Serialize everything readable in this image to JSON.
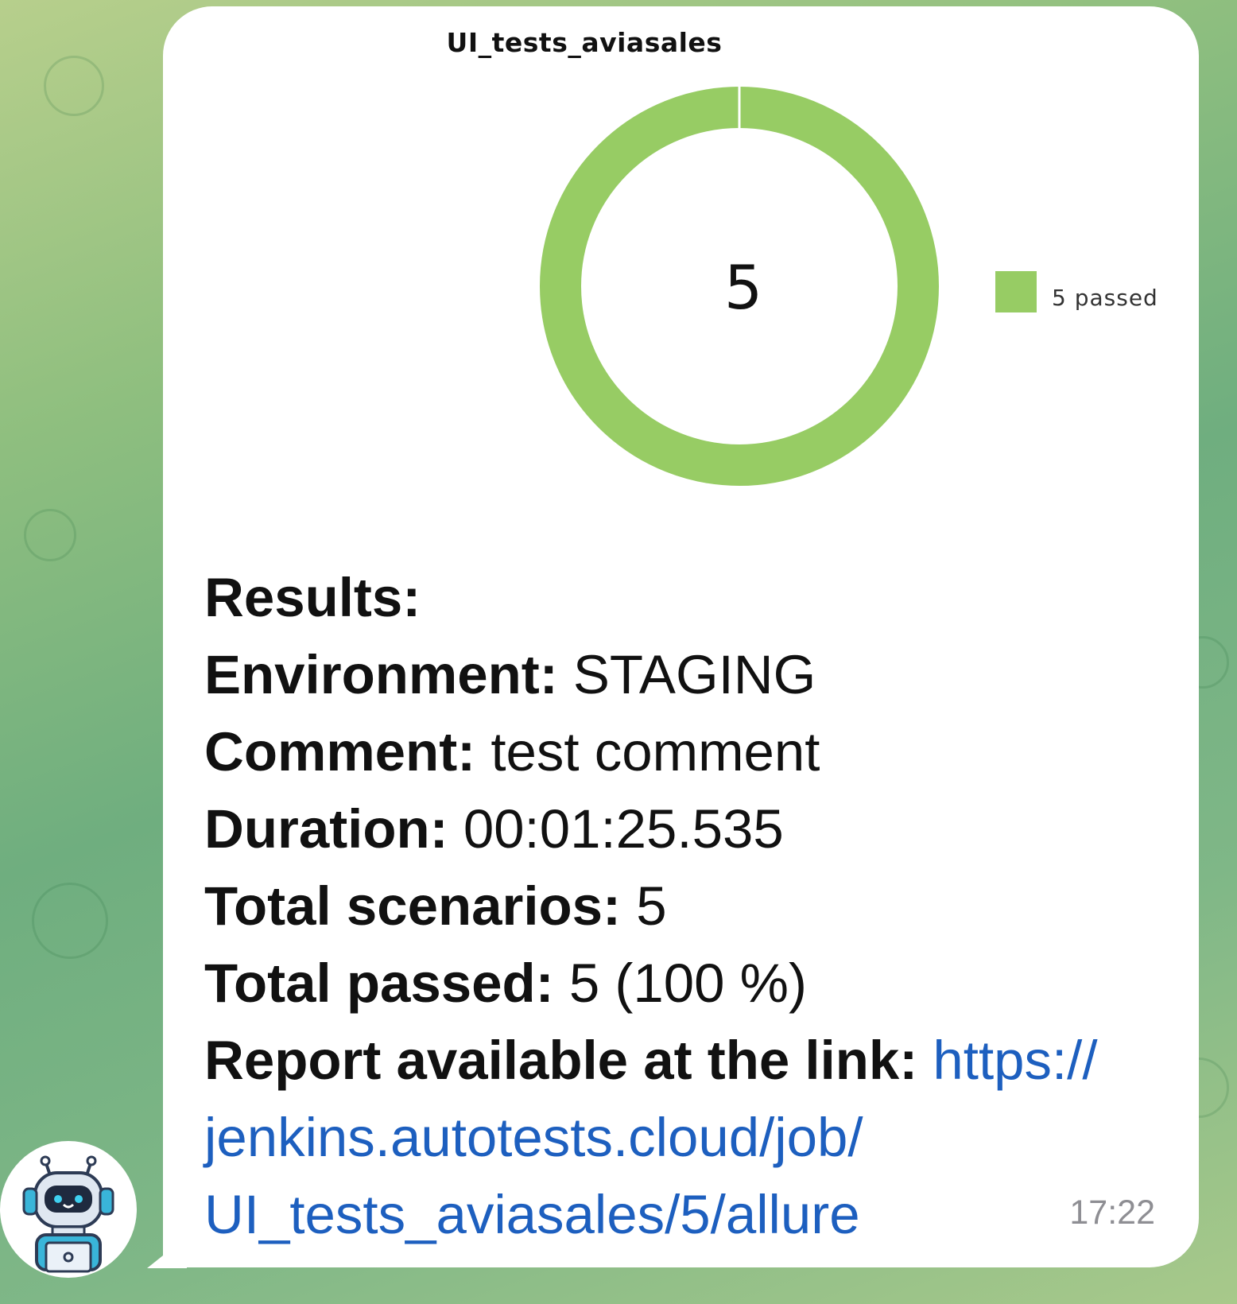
{
  "colors": {
    "passed": "#97cc64",
    "link": "#1d5fbf",
    "bubble": "#ffffff"
  },
  "chart_data": {
    "type": "pie",
    "title": "UI_tests_aviasales",
    "center_label": "5",
    "slices": [
      {
        "label": "5 passed",
        "value": 5,
        "color": "#97cc64"
      }
    ],
    "legend": {
      "placement": "right"
    }
  },
  "message": {
    "results_label": "Results:",
    "rows": [
      {
        "label": "Environment:",
        "value": "STAGING"
      },
      {
        "label": "Comment:",
        "value": "test comment"
      },
      {
        "label": "Duration:",
        "value": "00:01:25.535"
      },
      {
        "label": "Total scenarios:",
        "value": "5"
      },
      {
        "label": "Total passed:",
        "value": "5 (100 %)"
      }
    ],
    "report_label": "Report available at the link:",
    "link_parts": [
      "https://",
      "jenkins.autotests.cloud/job/",
      "UI_tests_aviasales/5/allure"
    ],
    "time": "17:22"
  },
  "avatar": {
    "icon": "robot-avatar-icon"
  }
}
